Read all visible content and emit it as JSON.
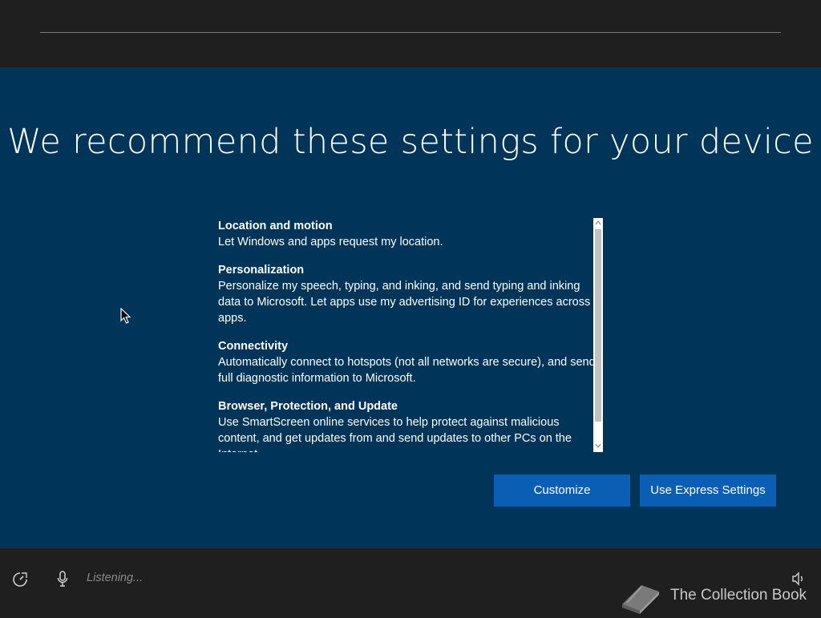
{
  "header": {
    "title": "We recommend these settings for your device"
  },
  "settings": [
    {
      "heading": "Location and motion",
      "description": "Let Windows and apps request my location."
    },
    {
      "heading": "Personalization",
      "description": "Personalize my speech, typing, and inking, and send typing and inking data to Microsoft. Let apps use my advertising ID for experiences across apps."
    },
    {
      "heading": "Connectivity",
      "description": "Automatically connect to hotspots (not all networks are secure), and send full diagnostic information to Microsoft."
    },
    {
      "heading": "Browser, Protection, and Update",
      "description": "Use SmartScreen online services to help protect against malicious content, and get updates from and send updates to other PCs on the Internet."
    }
  ],
  "buttons": {
    "customize": "Customize",
    "express": "Use Express Settings"
  },
  "footer": {
    "listening": "Listening...",
    "watermark": "The Collection Book"
  },
  "icons": {
    "ease_of_access": "ease-of-access-icon",
    "microphone": "microphone-icon",
    "volume": "volume-icon",
    "watermark": "book-icon"
  },
  "colors": {
    "main_background": "#003459",
    "button": "#0a5fb4",
    "frame": "#1f1f1f"
  }
}
